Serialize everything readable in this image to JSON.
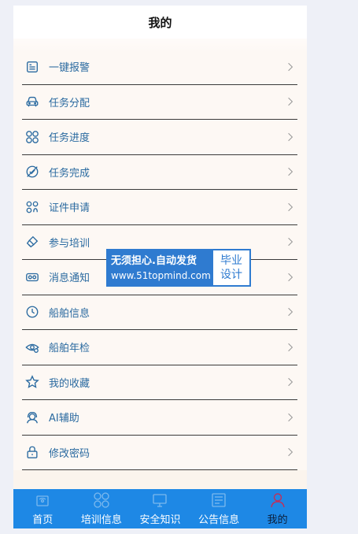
{
  "header": {
    "title": "我的"
  },
  "menu": [
    {
      "label": "一键报警",
      "icon": "alarm-panel-icon"
    },
    {
      "label": "任务分配",
      "icon": "car-icon"
    },
    {
      "label": "任务进度",
      "icon": "grid-circles-icon"
    },
    {
      "label": "任务完成",
      "icon": "check-badge-icon"
    },
    {
      "label": "证件申请",
      "icon": "people-grid-icon"
    },
    {
      "label": "参与培训",
      "icon": "brush-icon"
    },
    {
      "label": "消息通知",
      "icon": "vr-glasses-icon"
    },
    {
      "label": "船舶信息",
      "icon": "clock-icon"
    },
    {
      "label": "船舶年检",
      "icon": "eye-icon"
    },
    {
      "label": "我的收藏",
      "icon": "star-icon"
    },
    {
      "label": "AI辅助",
      "icon": "support-agent-icon"
    },
    {
      "label": "修改密码",
      "icon": "lock-icon"
    }
  ],
  "tabs": [
    {
      "label": "首页",
      "icon": "home-icon",
      "active": false
    },
    {
      "label": "培训信息",
      "icon": "grid-circles-icon",
      "active": false
    },
    {
      "label": "安全知识",
      "icon": "monitor-icon",
      "active": false
    },
    {
      "label": "公告信息",
      "icon": "notice-board-icon",
      "active": false
    },
    {
      "label": "我的",
      "icon": "person-icon",
      "active": true
    }
  ],
  "watermark": {
    "line1": "无须担心.自动发货",
    "line2": "www.51topmind.com",
    "side_line1": "毕业",
    "side_line2": "设计"
  },
  "colors": {
    "accent": "#1e88e5",
    "menu_text": "#2a6aa0",
    "active_tab": "#0b1e3a"
  }
}
